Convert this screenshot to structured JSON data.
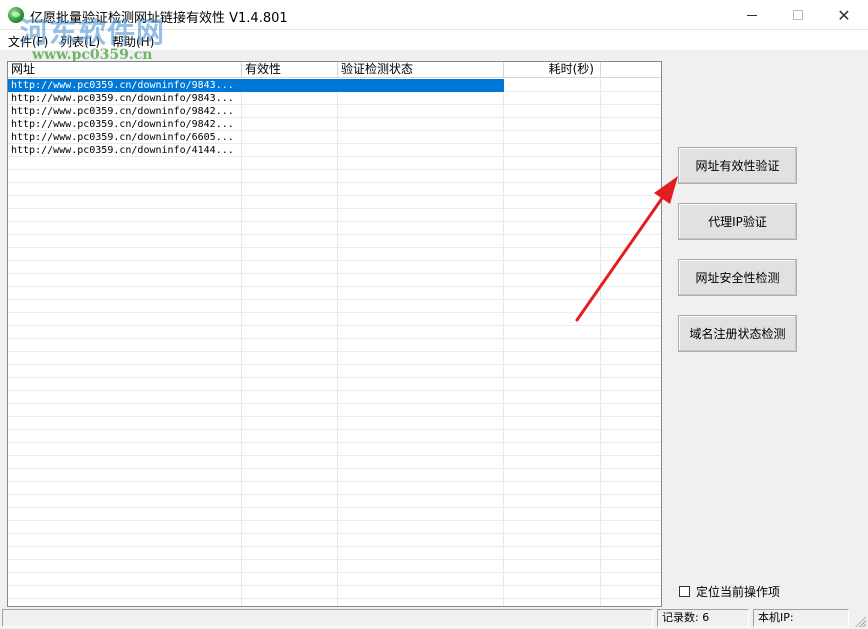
{
  "window": {
    "title": "亿愿批量验证检测网址链接有效性 V1.4.801",
    "icon": "app-globe-icon"
  },
  "watermark": {
    "logo_text": "河东软件网",
    "url_text": "www.pc0359.cn"
  },
  "menu": {
    "items": [
      {
        "label": "文件(F)"
      },
      {
        "label": "列表(L)"
      },
      {
        "label": "帮助(H)"
      }
    ]
  },
  "table": {
    "columns": [
      "网址",
      "有效性",
      "验证检测状态",
      "耗时(秒)"
    ],
    "rows": [
      {
        "url": "http://www.pc0359.cn/downinfo/9843...",
        "validity": "",
        "status": "",
        "time": "",
        "selected": true
      },
      {
        "url": "http://www.pc0359.cn/downinfo/9843...",
        "validity": "",
        "status": "",
        "time": ""
      },
      {
        "url": "http://www.pc0359.cn/downinfo/9842...",
        "validity": "",
        "status": "",
        "time": ""
      },
      {
        "url": "http://www.pc0359.cn/downinfo/9842...",
        "validity": "",
        "status": "",
        "time": ""
      },
      {
        "url": "http://www.pc0359.cn/downinfo/6605...",
        "validity": "",
        "status": "",
        "time": ""
      },
      {
        "url": "http://www.pc0359.cn/downinfo/4144...",
        "validity": "",
        "status": "",
        "time": ""
      }
    ]
  },
  "buttons": {
    "url_validity": "网址有效性验证",
    "proxy_ip": "代理IP验证",
    "url_security": "网址安全性检测",
    "domain_registration": "域名注册状态检测"
  },
  "options": {
    "locate_current_label": "定位当前操作项",
    "locate_current_checked": false
  },
  "status": {
    "record_count": "记录数: 6",
    "local_ip": "本机IP:"
  },
  "colors": {
    "selection": "#0078d7",
    "annotation_arrow": "#e02020",
    "watermark_blue": "#3c8cd2",
    "watermark_green": "#46a03c"
  }
}
